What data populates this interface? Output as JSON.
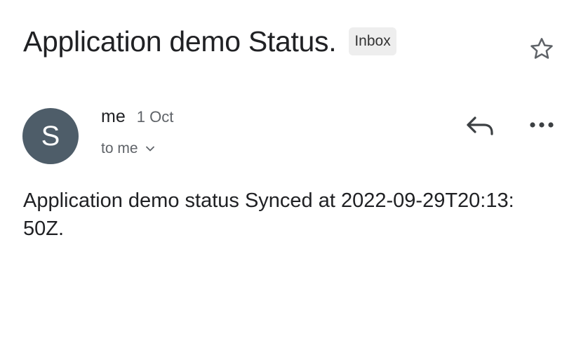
{
  "email": {
    "subject": "Application demo Status.",
    "label": "Inbox",
    "sender": {
      "avatar_initial": "S",
      "name": "me",
      "date": "1 Oct",
      "recipient": "to me"
    },
    "body": "Application demo status Synced at 2022-09-29T20:13:50Z."
  },
  "icons": {
    "star": "star-outline-icon",
    "reply": "reply-icon",
    "more": "more-horizontal-icon",
    "expand": "chevron-down-icon"
  },
  "colors": {
    "avatar_bg": "#4e5d69",
    "label_bg": "#eeeeee",
    "secondary_text": "#5f6368"
  }
}
